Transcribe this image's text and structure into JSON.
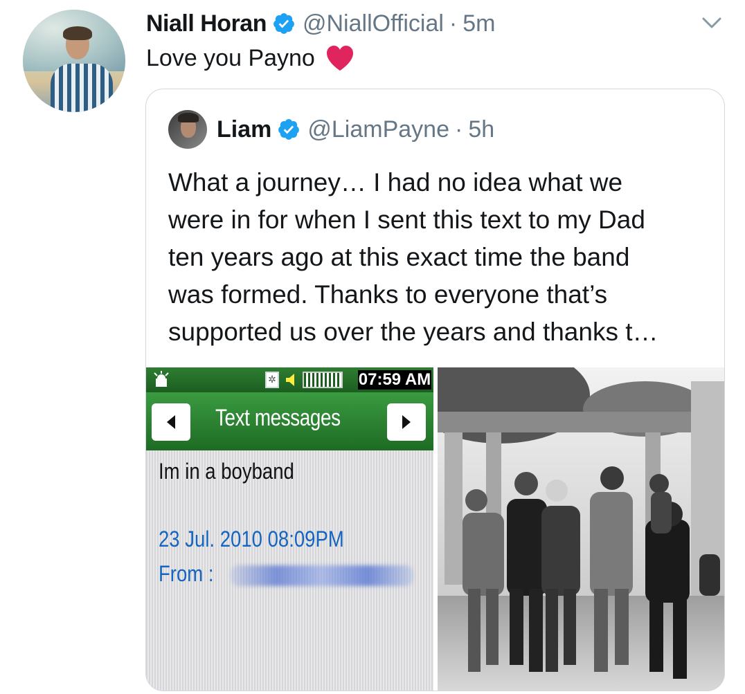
{
  "tweet": {
    "author_name": "Niall Horan",
    "author_handle": "@NiallOfficial",
    "separator": "·",
    "time": "5m",
    "text": "Love you Payno",
    "avatar_icon": "profile-photo",
    "verified_icon": "verified-badge-icon",
    "menu_icon": "chevron-down-icon",
    "emoji": "red-heart-icon"
  },
  "quoted": {
    "author_name": "Liam",
    "author_handle": "@LiamPayne",
    "separator": "·",
    "time": "5h",
    "text": "What a journey… I had no idea what we\nwere in for when I sent this text to my Dad\nten years ago at this exact time the band\nwas formed. Thanks to everyone that’s\nsupported us over the years and thanks t…",
    "media": [
      {
        "kind": "phone-screenshot",
        "status_time": "07:59 AM",
        "title": "Text messages",
        "message": "Im in a boyband",
        "date": "23 Jul. 2010 08:09PM",
        "from_label": "From :"
      },
      {
        "kind": "photo",
        "description_icon": "band-photo"
      }
    ]
  },
  "colors": {
    "text": "#14171a",
    "secondary": "#657786",
    "verified_blue": "#1da1f2",
    "heart_red": "#e0245e",
    "border": "#cfd9de"
  }
}
